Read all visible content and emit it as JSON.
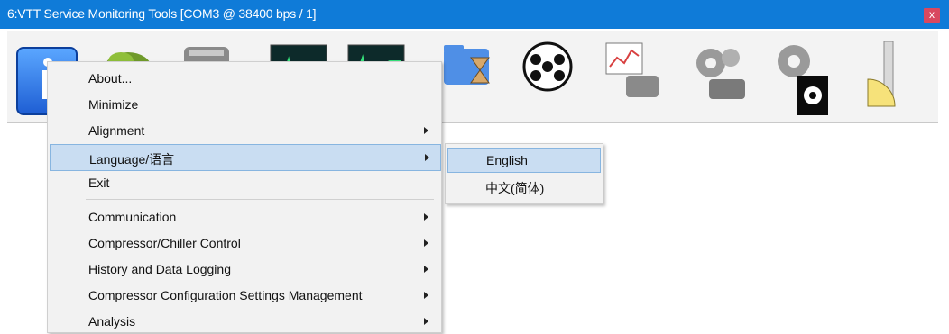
{
  "window": {
    "title": "6:VTT Service Monitoring Tools [COM3 @ 38400 bps / 1]",
    "close_glyph": "x",
    "titlebar_color": "#0f7bd8"
  },
  "toolbar": {
    "icons": [
      "info-icon",
      "plant-icon",
      "compressor-icon",
      "oscilloscope-icon",
      "oscilloscope-icon",
      "folder-hourglass-icon",
      "film-reel-icon",
      "chart-compressor-icon",
      "gears-compressor-icon",
      "gear-monitor-icon",
      "caliper-ruler-icon"
    ]
  },
  "menu": {
    "items": [
      {
        "label": "About...",
        "submenu": false
      },
      {
        "label": "Minimize",
        "submenu": false
      },
      {
        "label": "Alignment",
        "submenu": true
      },
      {
        "label": "Language/语言",
        "submenu": true,
        "selected": true
      },
      {
        "label": "Exit",
        "submenu": false
      },
      {
        "label": "Communication",
        "submenu": true
      },
      {
        "label": "Compressor/Chiller Control",
        "submenu": true
      },
      {
        "label": "History and Data Logging",
        "submenu": true
      },
      {
        "label": "Compressor Configuration Settings Management",
        "submenu": true
      },
      {
        "label": "Analysis",
        "submenu": true
      }
    ]
  },
  "language_submenu": {
    "items": [
      {
        "label": "English",
        "selected": true
      },
      {
        "label": "中文(简体)"
      }
    ]
  }
}
